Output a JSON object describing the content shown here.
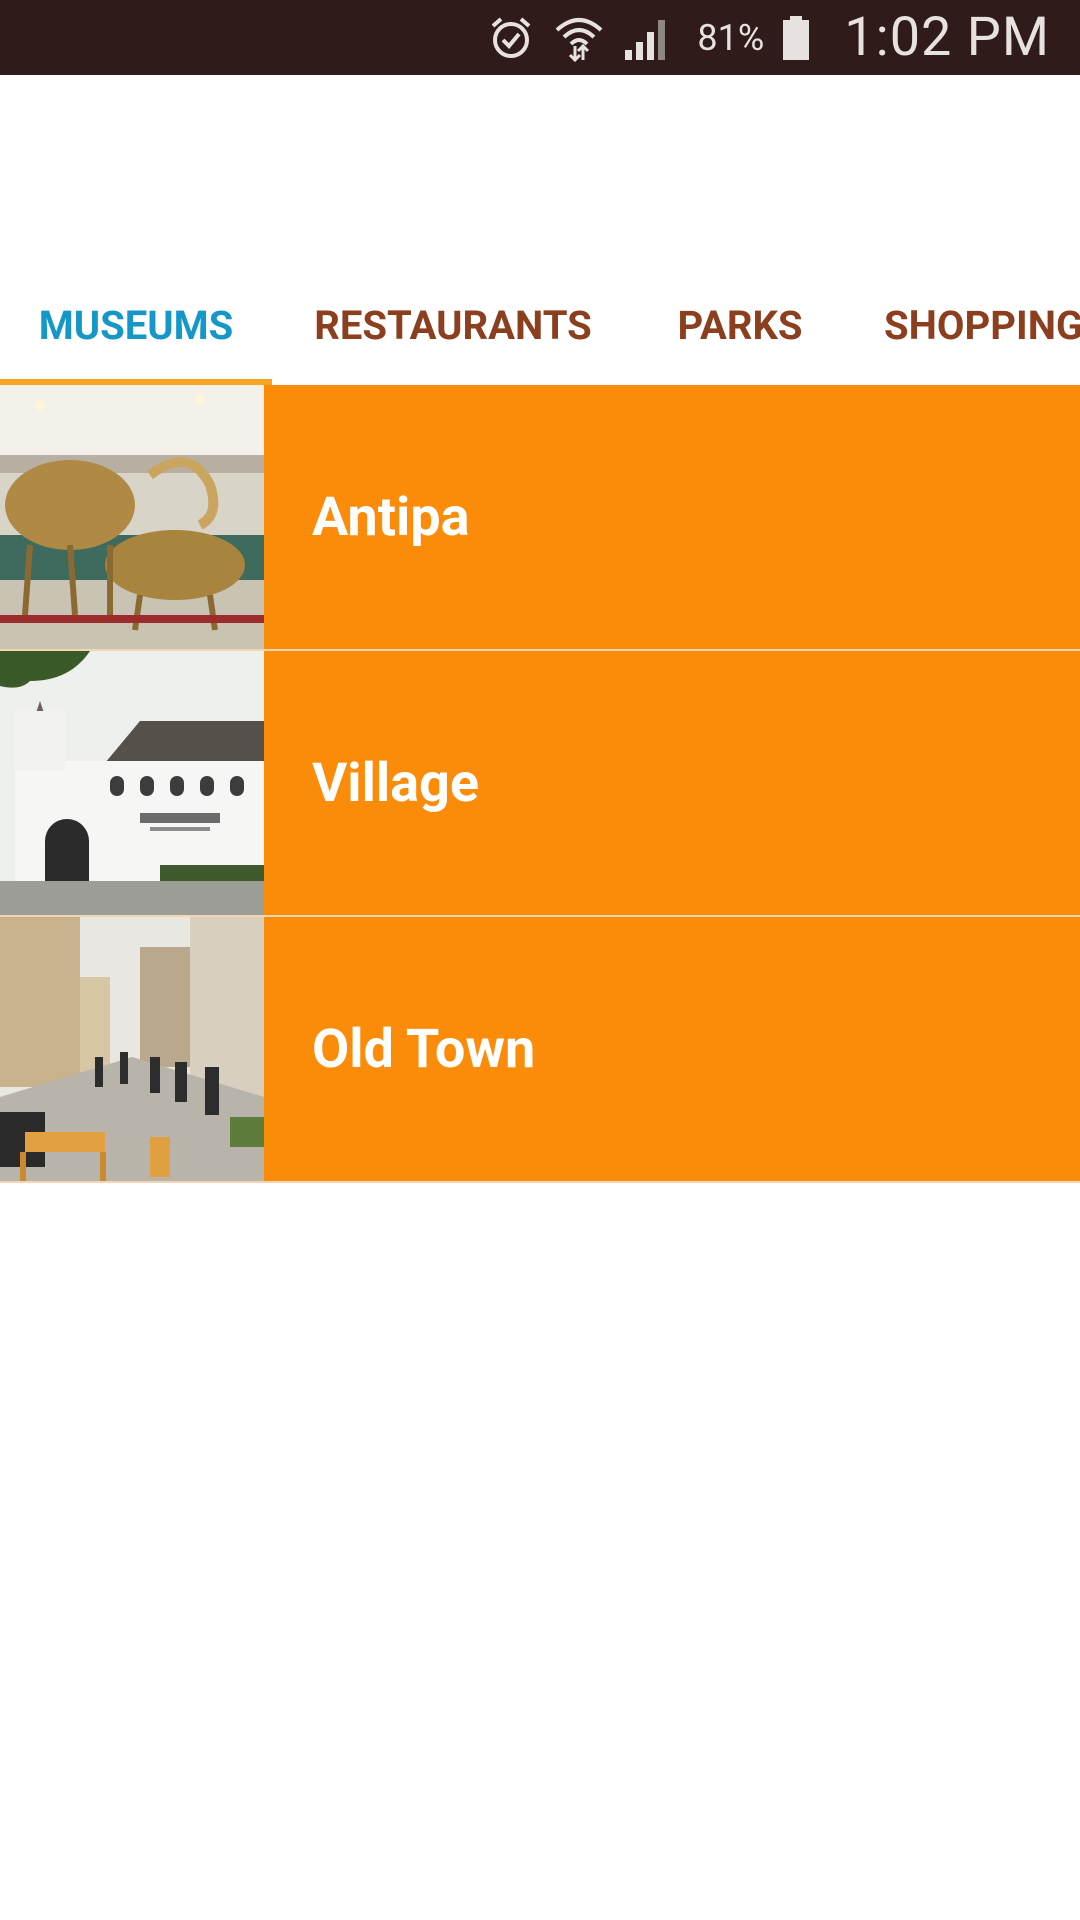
{
  "status_bar": {
    "battery_percent": "81%",
    "time": "1:02 PM",
    "icons": [
      "alarm-icon",
      "wifi-icon",
      "signal-icon",
      "battery-icon"
    ]
  },
  "tabs": [
    {
      "label": "MUSEUMS",
      "selected": true
    },
    {
      "label": "RESTAURANTS",
      "selected": false
    },
    {
      "label": "PARKS",
      "selected": false
    },
    {
      "label": "SHOPPING",
      "selected": false
    }
  ],
  "list": {
    "items": [
      {
        "label": "Antipa",
        "thumbnail": "museum-skeleton-thumbnail"
      },
      {
        "label": "Village",
        "thumbnail": "village-museum-thumbnail"
      },
      {
        "label": "Old Town",
        "thumbnail": "old-town-street-thumbnail"
      }
    ]
  },
  "colors": {
    "status_bar": "#2f1b19",
    "tab_selected": "#1597c8",
    "tab_inactive": "#8b3f1e",
    "tab_indicator": "#f5a623",
    "row_background": "#fb8c0a",
    "row_text": "#ffffff"
  }
}
